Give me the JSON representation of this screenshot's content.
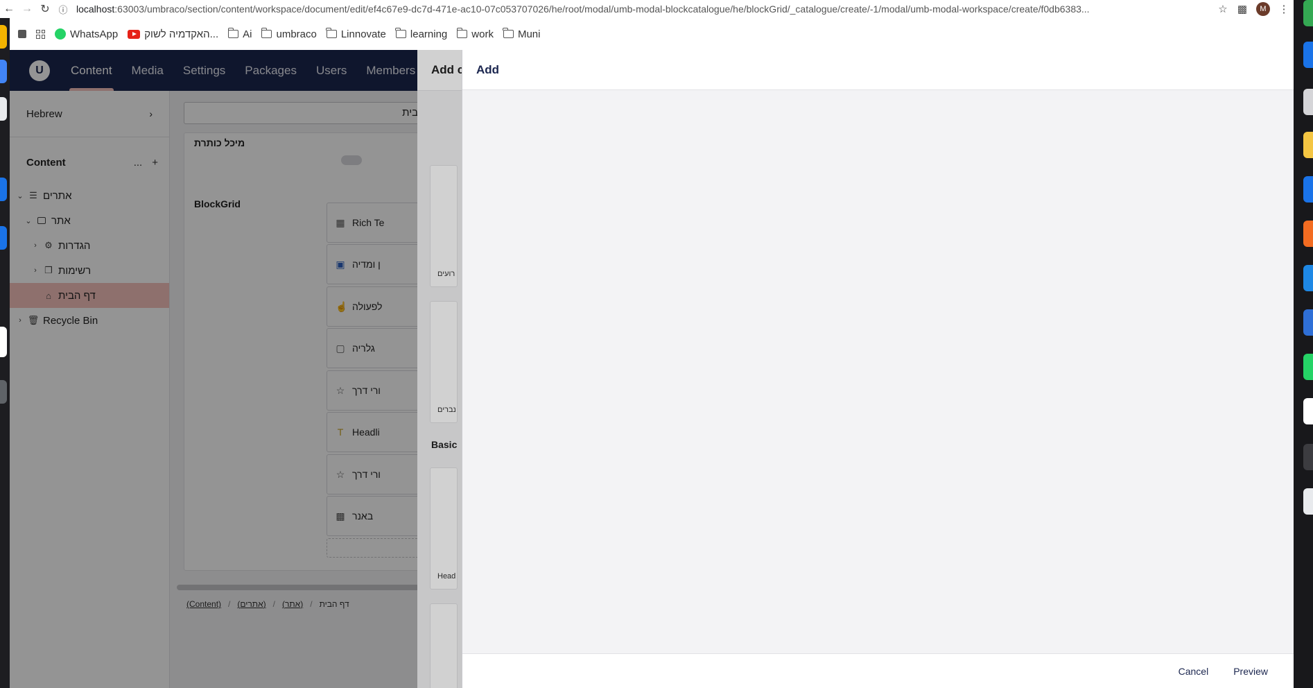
{
  "browser": {
    "url_host": "localhost",
    "url_rest": ":63003/umbraco/section/content/workspace/document/edit/ef4c67e9-dc7d-471e-ac10-07c053707026/he/root/modal/umb-modal-blockcatalogue/he/blockGrid/_catalogue/create/-1/modal/umb-modal-workspace/create/f0db6383...",
    "profile_initial": "M"
  },
  "bookmarks": [
    {
      "label": "WhatsApp",
      "icon": "whatsapp-icon"
    },
    {
      "label": "האקדמיה לשוק...",
      "icon": "youtube-icon"
    },
    {
      "label": "Ai",
      "icon": "folder-icon"
    },
    {
      "label": "umbraco",
      "icon": "folder-icon"
    },
    {
      "label": "Linnovate",
      "icon": "folder-icon"
    },
    {
      "label": "learning",
      "icon": "folder-icon"
    },
    {
      "label": "work",
      "icon": "folder-icon"
    },
    {
      "label": "Muni",
      "icon": "folder-icon"
    }
  ],
  "topnav": {
    "items": [
      "Content",
      "Media",
      "Settings",
      "Packages",
      "Users",
      "Members"
    ],
    "active": "Content"
  },
  "sidebar": {
    "culture": "Hebrew",
    "tree_title": "Content",
    "tree_actions": [
      "...",
      "+"
    ],
    "tree": [
      {
        "label": "אתרים",
        "icon": "layers-icon",
        "expanded": true
      },
      {
        "label": "אתר",
        "icon": "laptop-icon",
        "expanded": true
      },
      {
        "label": "הגדרות",
        "icon": "gear-icon",
        "expanded": false
      },
      {
        "label": "רשימות",
        "icon": "folders-icon",
        "expanded": false
      },
      {
        "label": "דף הבית",
        "icon": "home-icon",
        "selected": true
      },
      {
        "label": "Recycle Bin",
        "icon": "trash-icon",
        "expanded": false
      }
    ]
  },
  "editor": {
    "name_value": "דף הבית",
    "partial_label": "מיכל כותרת",
    "field_label": "BlockGrid",
    "blocks": [
      {
        "label": "Rich Te",
        "icon": "rich-text-icon"
      },
      {
        "label": "ן ומדיה",
        "icon": "image-text-icon"
      },
      {
        "label": "לפעולה",
        "icon": "hand-pointer-icon"
      },
      {
        "label": "גלריה",
        "icon": "gallery-icon"
      },
      {
        "label": "ורי דרך",
        "icon": "star-icon"
      },
      {
        "label": "Headli",
        "icon": "heading-icon"
      },
      {
        "label": "ורי דרך",
        "icon": "star-icon"
      },
      {
        "label": "באנר",
        "icon": "banner-icon"
      }
    ],
    "breadcrumbs": [
      "(Content)",
      "(אתרים)",
      "(אתר)",
      "דף הבית"
    ]
  },
  "catalogue": {
    "title": "Add c",
    "cards": [
      "רועים",
      "נברים",
      "Head"
    ],
    "group": "Basic"
  },
  "workspace_modal": {
    "title": "Add",
    "cancel_label": "Cancel",
    "preview_label": "Preview"
  },
  "colors": {
    "topnav_bg": "#1b264f",
    "selected_bg": "#f5c1bc",
    "surface": "#f3f3f5"
  }
}
